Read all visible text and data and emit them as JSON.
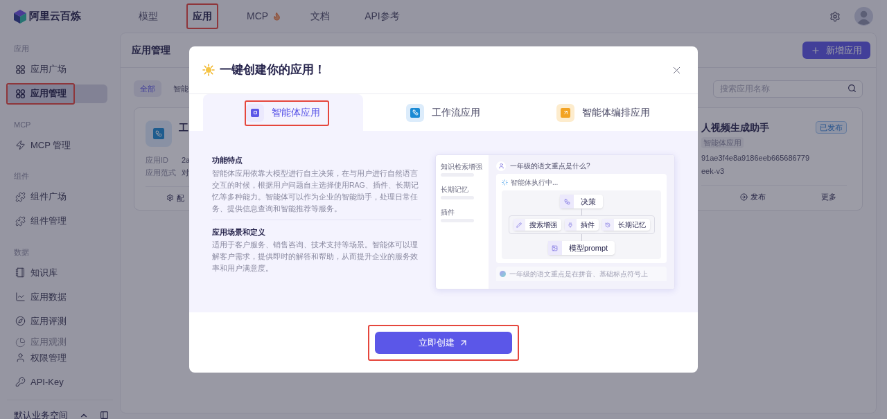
{
  "header": {
    "logo": "阿里云百炼",
    "nav": [
      {
        "label": "模型",
        "selected": false,
        "highlighted": false,
        "hot": false
      },
      {
        "label": "应用",
        "selected": true,
        "highlighted": true,
        "hot": false
      },
      {
        "label": "MCP",
        "selected": false,
        "highlighted": false,
        "hot": true
      },
      {
        "label": "文档",
        "selected": false,
        "highlighted": false,
        "hot": false
      },
      {
        "label": "API参考",
        "selected": false,
        "highlighted": false,
        "hot": false
      }
    ]
  },
  "sidebar": {
    "sections": [
      {
        "heading": "应用",
        "items": [
          {
            "label": "应用广场",
            "selected": false,
            "highlighted": false,
            "faded": false
          },
          {
            "label": "应用管理",
            "selected": true,
            "highlighted": true,
            "faded": false
          }
        ]
      },
      {
        "heading": "MCP",
        "items": [
          {
            "label": "MCP 管理",
            "selected": false,
            "highlighted": false,
            "faded": false
          }
        ]
      },
      {
        "heading": "组件",
        "items": [
          {
            "label": "组件广场",
            "selected": false,
            "highlighted": false,
            "faded": false
          },
          {
            "label": "组件管理",
            "selected": false,
            "highlighted": false,
            "faded": false
          }
        ]
      },
      {
        "heading": "数据",
        "items": [
          {
            "label": "知识库",
            "selected": false,
            "highlighted": false,
            "faded": false
          },
          {
            "label": "应用数据",
            "selected": false,
            "highlighted": false,
            "faded": false
          },
          {
            "label": "应用评测",
            "selected": false,
            "highlighted": false,
            "faded": false
          },
          {
            "label": "应用观测",
            "selected": false,
            "highlighted": false,
            "faded": true
          }
        ]
      }
    ],
    "bottom_items": [
      "权限管理",
      "API-Key"
    ],
    "workspace": "默认业务空间"
  },
  "main": {
    "title": "应用管理",
    "new_button": "新增应用",
    "filters": [
      {
        "label": "全部",
        "selected": true
      },
      {
        "label": "智能",
        "selected": false
      }
    ],
    "search": {
      "placeholder": "搜索应用名称"
    },
    "left_card": {
      "title": "工",
      "fields": [
        {
          "label": "应用ID",
          "value": "2a"
        },
        {
          "label": "应用范式",
          "value": "对"
        }
      ],
      "action": "配"
    },
    "right_card": {
      "title": "人视频生成助手",
      "status": "已发布",
      "tag": "智能体应用",
      "fields": [
        "91ae3f4e8a9186eeb665686779",
        "eek-v3"
      ],
      "actions": [
        "发布",
        "更多"
      ]
    }
  },
  "modal": {
    "title": "一键创建你的应用！",
    "tabs": [
      {
        "label": "智能体应用",
        "selected": true,
        "highlighted": true
      },
      {
        "label": "工作流应用",
        "selected": false,
        "highlighted": false
      },
      {
        "label": "智能体编排应用",
        "selected": false,
        "highlighted": false
      }
    ],
    "sections": [
      {
        "heading": "功能特点",
        "text": "智能体应用依靠大模型进行自主决策，在与用户进行自然语言交互的时候，根据用户问题自主选择使用RAG、插件、长期记忆等多种能力。智能体可以作为企业的智能助手，处理日常任务、提供信息查询和智能推荐等服务。"
      },
      {
        "heading": "应用场景和定义",
        "text": "适用于客户服务、销售咨询、技术支持等场景。智能体可以理解客户需求，提供即时的解答和帮助，从而提升企业的服务效率和用户满意度。"
      }
    ],
    "preview": {
      "side_labels": [
        "知识检索增强",
        "长期记忆",
        "插件"
      ],
      "question": "一年级的语文重点是什么?",
      "status": "智能体执行中...",
      "top_node": "决策",
      "middle_nodes": [
        "搜索增强",
        "插件",
        "长期记忆"
      ],
      "bottom_node": "模型prompt",
      "answer": "一年级的语文重点是在拼音、基础标点符号上"
    },
    "create_button": {
      "label": "立即创建",
      "highlighted": true
    }
  }
}
